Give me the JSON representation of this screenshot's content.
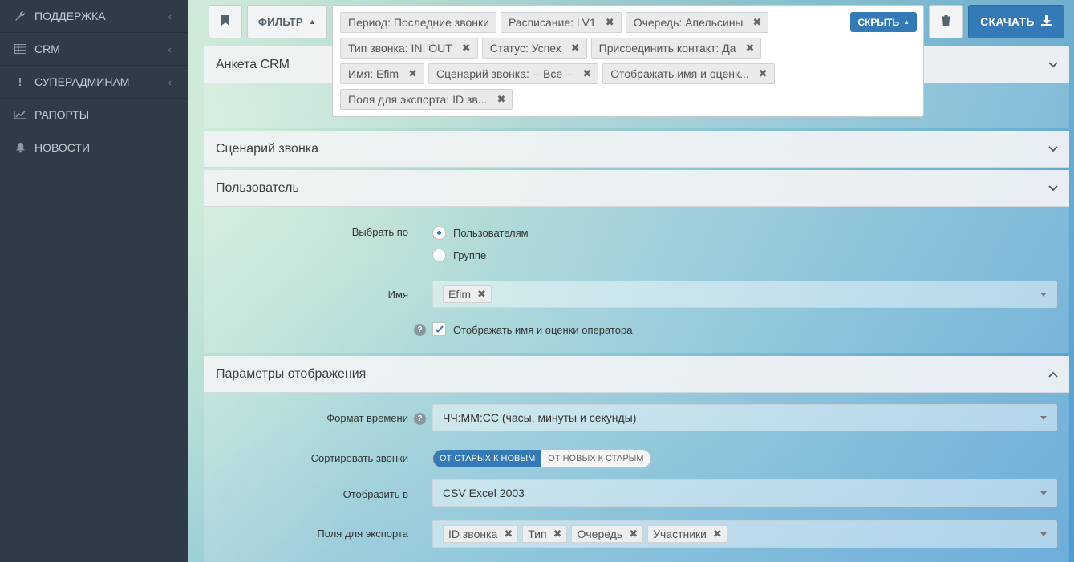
{
  "sidebar": {
    "items": [
      {
        "label": "Поддержка",
        "icon": "wrench-icon"
      },
      {
        "label": "CRM",
        "icon": "table-icon"
      },
      {
        "label": "Суперадминам",
        "icon": "exclamation-icon"
      },
      {
        "label": "Рапорты",
        "icon": "chart-line-icon"
      },
      {
        "label": "Новости",
        "icon": "bell-icon"
      }
    ]
  },
  "toolbar": {
    "filter_label": "Фильтр",
    "hide_label": "Скрыть",
    "download_label": "Скачать"
  },
  "filters": {
    "chips": [
      "Период: Последние звонки",
      "Расписание: LV1",
      "Очередь: Апельсины",
      "Тип звонка: IN, OUT",
      "Статус: Успех",
      "Присоединить контакт: Да",
      "Имя: Efim",
      "Сценарий звонка: -- Все --",
      "Отображать имя и оценк...",
      "Поля для экспорта: ID зв..."
    ]
  },
  "panels": {
    "crm_title": "Анкета CRM",
    "scenario_title": "Сценарий звонка",
    "user_title": "Пользователь",
    "display_title": "Параметры отображения"
  },
  "user": {
    "select_by_label": "Выбрать по",
    "option_users": "Пользователям",
    "option_group": "Группе",
    "selected": "users",
    "name_label": "Имя",
    "name_value": "Efim",
    "show_operator_label": "Отображать имя и оценки оператора",
    "show_operator_checked": true
  },
  "display": {
    "time_format_label": "Формат времени",
    "time_format_value": "ЧЧ:ММ:СС (часы, минуты и секунды)",
    "sort_label": "Сортировать звонки",
    "sort_old_new": "От старых к новым",
    "sort_new_old": "От новых к старым",
    "sort_selected": "old_new",
    "render_in_label": "Отобразить в",
    "render_in_value": "CSV Excel 2003",
    "export_fields_label": "Поля для экспорта",
    "export_fields": [
      "ID звонка",
      "Тип",
      "Очередь",
      "Участники"
    ]
  },
  "colors": {
    "accent": "#337ab7",
    "sidebar_bg": "#2f3b46"
  }
}
